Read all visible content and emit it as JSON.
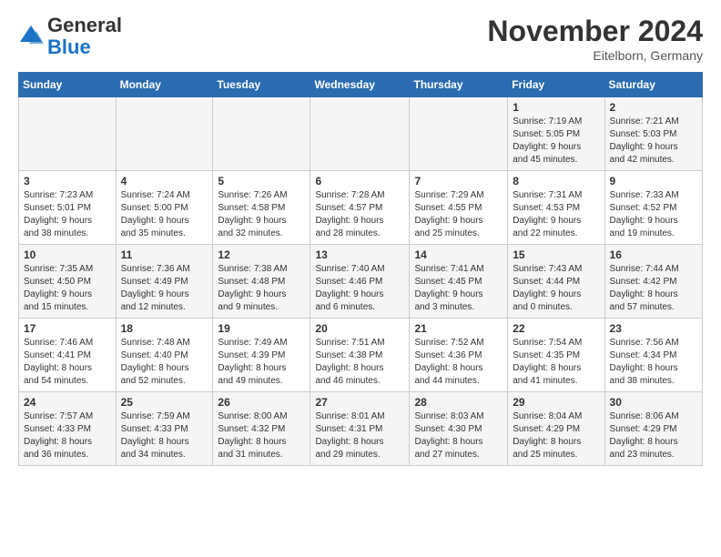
{
  "header": {
    "logo_line1": "General",
    "logo_line2": "Blue",
    "month": "November 2024",
    "location": "Eitelborn, Germany"
  },
  "weekdays": [
    "Sunday",
    "Monday",
    "Tuesday",
    "Wednesday",
    "Thursday",
    "Friday",
    "Saturday"
  ],
  "weeks": [
    [
      {
        "day": "",
        "info": ""
      },
      {
        "day": "",
        "info": ""
      },
      {
        "day": "",
        "info": ""
      },
      {
        "day": "",
        "info": ""
      },
      {
        "day": "",
        "info": ""
      },
      {
        "day": "1",
        "info": "Sunrise: 7:19 AM\nSunset: 5:05 PM\nDaylight: 9 hours\nand 45 minutes."
      },
      {
        "day": "2",
        "info": "Sunrise: 7:21 AM\nSunset: 5:03 PM\nDaylight: 9 hours\nand 42 minutes."
      }
    ],
    [
      {
        "day": "3",
        "info": "Sunrise: 7:23 AM\nSunset: 5:01 PM\nDaylight: 9 hours\nand 38 minutes."
      },
      {
        "day": "4",
        "info": "Sunrise: 7:24 AM\nSunset: 5:00 PM\nDaylight: 9 hours\nand 35 minutes."
      },
      {
        "day": "5",
        "info": "Sunrise: 7:26 AM\nSunset: 4:58 PM\nDaylight: 9 hours\nand 32 minutes."
      },
      {
        "day": "6",
        "info": "Sunrise: 7:28 AM\nSunset: 4:57 PM\nDaylight: 9 hours\nand 28 minutes."
      },
      {
        "day": "7",
        "info": "Sunrise: 7:29 AM\nSunset: 4:55 PM\nDaylight: 9 hours\nand 25 minutes."
      },
      {
        "day": "8",
        "info": "Sunrise: 7:31 AM\nSunset: 4:53 PM\nDaylight: 9 hours\nand 22 minutes."
      },
      {
        "day": "9",
        "info": "Sunrise: 7:33 AM\nSunset: 4:52 PM\nDaylight: 9 hours\nand 19 minutes."
      }
    ],
    [
      {
        "day": "10",
        "info": "Sunrise: 7:35 AM\nSunset: 4:50 PM\nDaylight: 9 hours\nand 15 minutes."
      },
      {
        "day": "11",
        "info": "Sunrise: 7:36 AM\nSunset: 4:49 PM\nDaylight: 9 hours\nand 12 minutes."
      },
      {
        "day": "12",
        "info": "Sunrise: 7:38 AM\nSunset: 4:48 PM\nDaylight: 9 hours\nand 9 minutes."
      },
      {
        "day": "13",
        "info": "Sunrise: 7:40 AM\nSunset: 4:46 PM\nDaylight: 9 hours\nand 6 minutes."
      },
      {
        "day": "14",
        "info": "Sunrise: 7:41 AM\nSunset: 4:45 PM\nDaylight: 9 hours\nand 3 minutes."
      },
      {
        "day": "15",
        "info": "Sunrise: 7:43 AM\nSunset: 4:44 PM\nDaylight: 9 hours\nand 0 minutes."
      },
      {
        "day": "16",
        "info": "Sunrise: 7:44 AM\nSunset: 4:42 PM\nDaylight: 8 hours\nand 57 minutes."
      }
    ],
    [
      {
        "day": "17",
        "info": "Sunrise: 7:46 AM\nSunset: 4:41 PM\nDaylight: 8 hours\nand 54 minutes."
      },
      {
        "day": "18",
        "info": "Sunrise: 7:48 AM\nSunset: 4:40 PM\nDaylight: 8 hours\nand 52 minutes."
      },
      {
        "day": "19",
        "info": "Sunrise: 7:49 AM\nSunset: 4:39 PM\nDaylight: 8 hours\nand 49 minutes."
      },
      {
        "day": "20",
        "info": "Sunrise: 7:51 AM\nSunset: 4:38 PM\nDaylight: 8 hours\nand 46 minutes."
      },
      {
        "day": "21",
        "info": "Sunrise: 7:52 AM\nSunset: 4:36 PM\nDaylight: 8 hours\nand 44 minutes."
      },
      {
        "day": "22",
        "info": "Sunrise: 7:54 AM\nSunset: 4:35 PM\nDaylight: 8 hours\nand 41 minutes."
      },
      {
        "day": "23",
        "info": "Sunrise: 7:56 AM\nSunset: 4:34 PM\nDaylight: 8 hours\nand 38 minutes."
      }
    ],
    [
      {
        "day": "24",
        "info": "Sunrise: 7:57 AM\nSunset: 4:33 PM\nDaylight: 8 hours\nand 36 minutes."
      },
      {
        "day": "25",
        "info": "Sunrise: 7:59 AM\nSunset: 4:33 PM\nDaylight: 8 hours\nand 34 minutes."
      },
      {
        "day": "26",
        "info": "Sunrise: 8:00 AM\nSunset: 4:32 PM\nDaylight: 8 hours\nand 31 minutes."
      },
      {
        "day": "27",
        "info": "Sunrise: 8:01 AM\nSunset: 4:31 PM\nDaylight: 8 hours\nand 29 minutes."
      },
      {
        "day": "28",
        "info": "Sunrise: 8:03 AM\nSunset: 4:30 PM\nDaylight: 8 hours\nand 27 minutes."
      },
      {
        "day": "29",
        "info": "Sunrise: 8:04 AM\nSunset: 4:29 PM\nDaylight: 8 hours\nand 25 minutes."
      },
      {
        "day": "30",
        "info": "Sunrise: 8:06 AM\nSunset: 4:29 PM\nDaylight: 8 hours\nand 23 minutes."
      }
    ]
  ]
}
